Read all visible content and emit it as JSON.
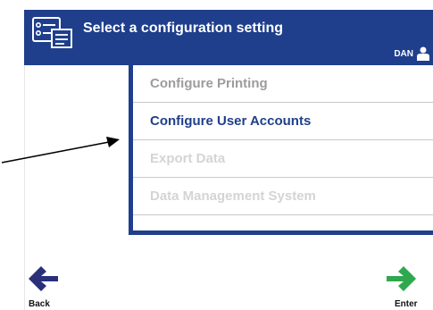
{
  "header": {
    "title": "Select a configuration setting",
    "user": "DAN"
  },
  "menu": {
    "items": [
      {
        "label": "Configure Printing",
        "state": "enabled"
      },
      {
        "label": "Configure User Accounts",
        "state": "active"
      },
      {
        "label": "Export Data",
        "state": "disabled"
      },
      {
        "label": "Data Management System",
        "state": "disabled"
      }
    ]
  },
  "nav": {
    "back_label": "Back",
    "enter_label": "Enter"
  },
  "colors": {
    "header_bg": "#1f3f8c",
    "back_arrow": "#2a2f7a",
    "enter_arrow": "#2fa84f",
    "annotation_arrow": "#000000"
  },
  "icons": {
    "header": "settings-panel-icon",
    "user": "user-icon",
    "back": "arrow-left-icon",
    "enter": "arrow-right-icon"
  }
}
